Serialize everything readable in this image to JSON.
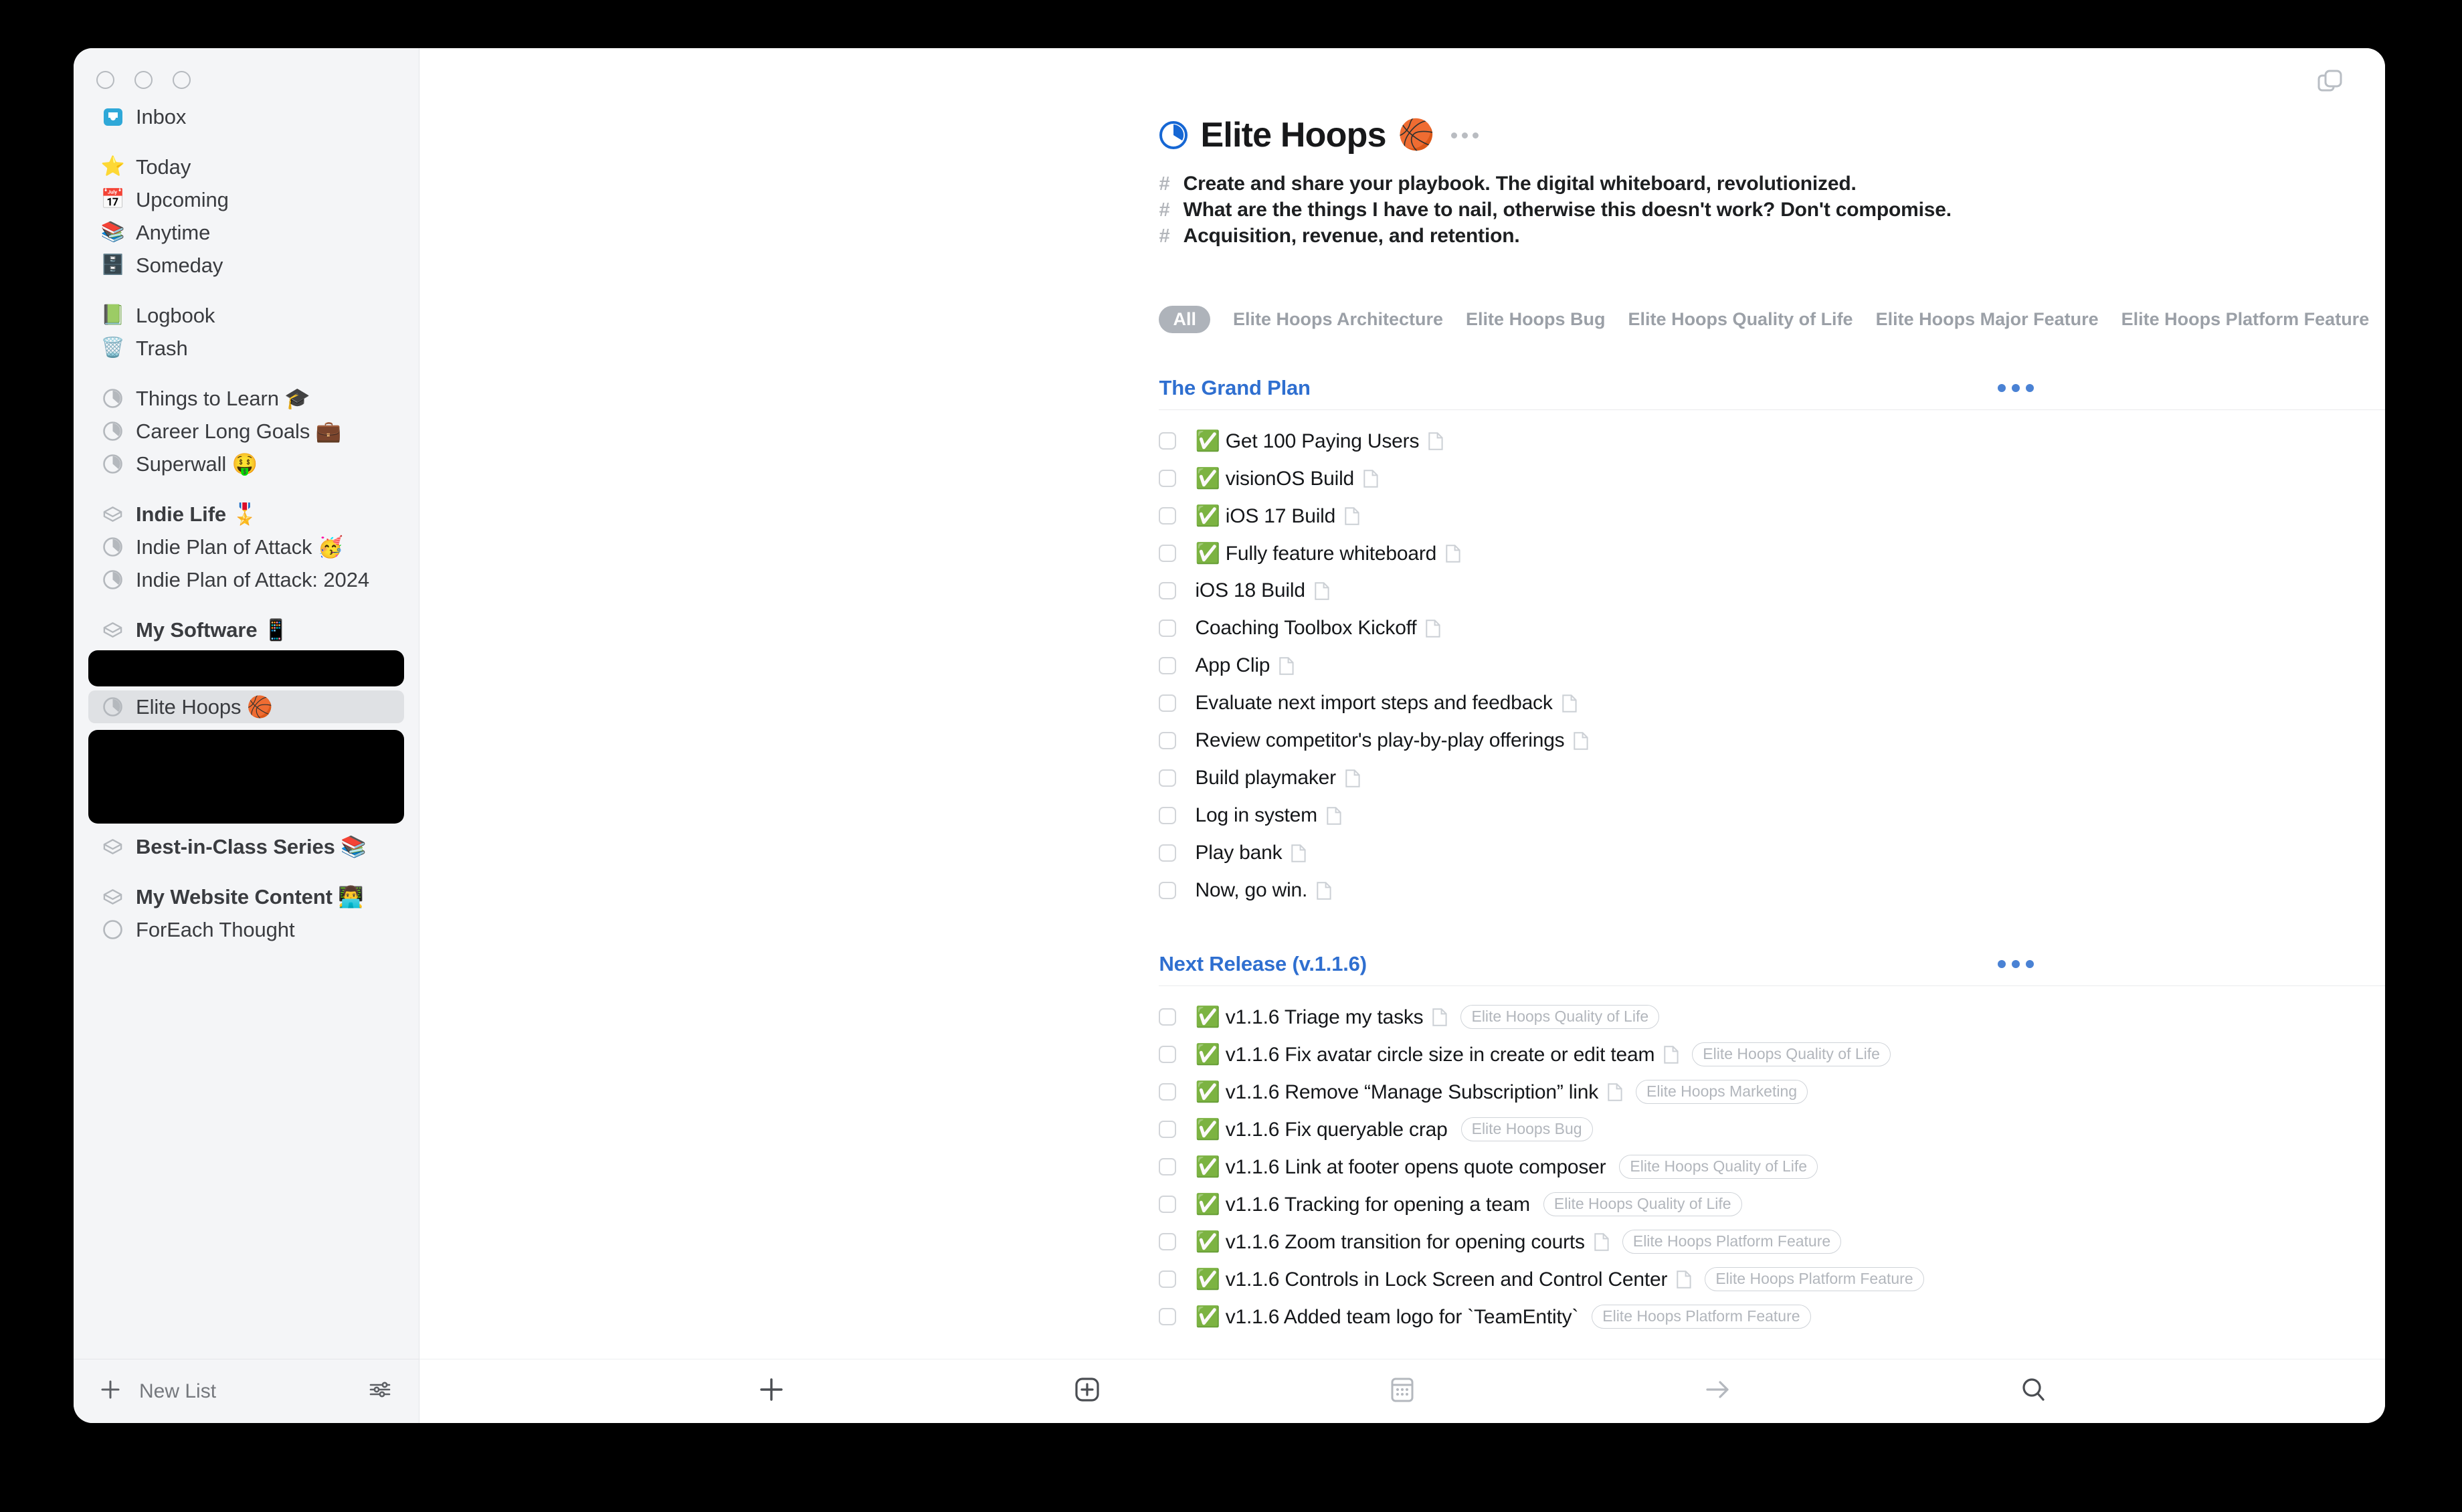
{
  "window": {
    "traffic_lights": [
      "close",
      "minimize",
      "zoom"
    ],
    "top_right_icon": "windows-stack-icon"
  },
  "sidebar": {
    "groups": [
      {
        "items": [
          {
            "label": "Inbox",
            "icon": "inbox-tray-icon",
            "bold": false
          }
        ]
      },
      {
        "items": [
          {
            "label": "Today",
            "icon": "star-icon",
            "bold": false
          },
          {
            "label": "Upcoming",
            "icon": "calendar-icon",
            "bold": false
          },
          {
            "label": "Anytime",
            "icon": "layers-icon",
            "bold": false
          },
          {
            "label": "Someday",
            "icon": "archive-box-icon",
            "bold": false
          }
        ]
      },
      {
        "items": [
          {
            "label": "Logbook",
            "icon": "green-book-icon",
            "bold": false
          },
          {
            "label": "Trash",
            "icon": "trash-icon",
            "bold": false
          }
        ]
      },
      {
        "items": [
          {
            "label": "Things to Learn 🎓",
            "icon": "project-pie-icon",
            "bold": false
          },
          {
            "label": "Career Long Goals 💼",
            "icon": "project-pie-icon",
            "bold": false
          },
          {
            "label": "Superwall 🤑",
            "icon": "project-pie-icon",
            "bold": false
          }
        ]
      },
      {
        "items": [
          {
            "label": "Indie Life 🎖️",
            "icon": "area-icon",
            "bold": true
          },
          {
            "label": "Indie Plan of Attack 🥳",
            "icon": "project-pie-icon",
            "bold": false
          },
          {
            "label": "Indie Plan of Attack: 2024",
            "icon": "project-pie-icon",
            "bold": false
          }
        ]
      },
      {
        "items": [
          {
            "label": "My Software 📱",
            "icon": "area-icon",
            "bold": true
          }
        ]
      },
      {
        "redacted": true
      },
      {
        "items": [
          {
            "label": "Elite Hoops 🏀",
            "icon": "project-pie-icon",
            "bold": false,
            "selected": true
          }
        ]
      },
      {
        "redacted_tall": true
      },
      {
        "items": [
          {
            "label": "Best-in-Class Series 📚",
            "icon": "area-icon",
            "bold": true
          }
        ]
      },
      {
        "items": [
          {
            "label": "My Website Content 👨‍💻",
            "icon": "area-icon",
            "bold": true
          },
          {
            "label": "ForEach Thought",
            "icon": "circle-empty-icon",
            "bold": false
          }
        ]
      }
    ],
    "footer": {
      "new_list_label": "New List",
      "new_list_icon": "plus-icon",
      "settings_icon": "sliders-icon"
    }
  },
  "project": {
    "title": "Elite Hoops",
    "emoji": "🏀",
    "progress_icon": "project-pie-icon",
    "more_icon": "ellipsis-icon",
    "notes": [
      "Create and share your playbook. The digital whiteboard, revolutionized.",
      "What are the things I have to nail, otherwise this doesn't work? Don't compomise.",
      "Acquisition, revenue, and retention."
    ],
    "note_bullet": "#"
  },
  "tag_filter": {
    "selected": "All",
    "tags": [
      "Elite Hoops Architecture",
      "Elite Hoops Bug",
      "Elite Hoops Quality of Life",
      "Elite Hoops Major Feature",
      "Elite Hoops Platform Feature"
    ],
    "overflow_icon": "ellipsis-icon"
  },
  "sections": [
    {
      "title": "The Grand Plan",
      "menu_icon": "ellipsis-icon",
      "items": [
        {
          "title": "✅ Get 100 Paying Users",
          "note": true,
          "tags": []
        },
        {
          "title": "✅ visionOS Build",
          "note": true,
          "tags": []
        },
        {
          "title": "✅ iOS 17 Build",
          "note": true,
          "tags": []
        },
        {
          "title": "✅ Fully feature whiteboard",
          "note": true,
          "tags": []
        },
        {
          "title": "iOS 18 Build",
          "note": true,
          "tags": []
        },
        {
          "title": "Coaching Toolbox Kickoff",
          "note": true,
          "tags": []
        },
        {
          "title": "App Clip",
          "note": true,
          "tags": []
        },
        {
          "title": "Evaluate next import steps and feedback",
          "note": true,
          "tags": []
        },
        {
          "title": "Review competitor's play-by-play offerings",
          "note": true,
          "tags": []
        },
        {
          "title": "Build playmaker",
          "note": true,
          "tags": []
        },
        {
          "title": "Log in system",
          "note": true,
          "tags": []
        },
        {
          "title": "Play bank",
          "note": true,
          "tags": []
        },
        {
          "title": "Now, go win.",
          "note": true,
          "tags": []
        }
      ]
    },
    {
      "title": "Next Release (v.1.1.6)",
      "menu_icon": "ellipsis-icon",
      "items": [
        {
          "title": "✅ v1.1.6 Triage my tasks",
          "note": true,
          "tags": [
            "Elite Hoops Quality of Life"
          ]
        },
        {
          "title": "✅ v1.1.6  Fix avatar circle size in create or edit team",
          "note": true,
          "tags": [
            "Elite Hoops Quality of Life"
          ]
        },
        {
          "title": "✅ v1.1.6 Remove “Manage Subscription” link",
          "note": true,
          "tags": [
            "Elite Hoops Marketing"
          ]
        },
        {
          "title": "✅ v1.1.6 Fix queryable crap",
          "note": false,
          "tags": [
            "Elite Hoops Bug"
          ]
        },
        {
          "title": "✅ v1.1.6 Link at footer opens quote composer",
          "note": false,
          "tags": [
            "Elite Hoops Quality of Life"
          ]
        },
        {
          "title": "✅ v1.1.6 Tracking for opening a team",
          "note": false,
          "tags": [
            "Elite Hoops Quality of Life"
          ]
        },
        {
          "title": "✅ v1.1.6 Zoom transition for opening courts",
          "note": true,
          "tags": [
            "Elite Hoops Platform Feature"
          ]
        },
        {
          "title": "✅ v1.1.6 Controls in Lock Screen and Control Center",
          "note": true,
          "tags": [
            "Elite Hoops Platform Feature"
          ]
        },
        {
          "title": "✅ v1.1.6 Added team logo for `TeamEntity`",
          "note": false,
          "tags": [
            "Elite Hoops Platform Feature"
          ]
        }
      ]
    }
  ],
  "toolbar": {
    "buttons": [
      {
        "icon": "plus-icon",
        "name": "new-todo-button"
      },
      {
        "icon": "plus-in-box-icon",
        "name": "new-heading-button"
      },
      {
        "icon": "calendar-icon",
        "name": "when-button"
      },
      {
        "icon": "arrow-right-icon",
        "name": "move-button"
      },
      {
        "icon": "search-icon",
        "name": "search-button"
      }
    ]
  },
  "colors": {
    "accent_blue": "#2f6fd0",
    "sidebar_bg": "#f4f5f7",
    "selected_row": "#dfe1e4",
    "tag_gray": "#b2b6bc"
  }
}
